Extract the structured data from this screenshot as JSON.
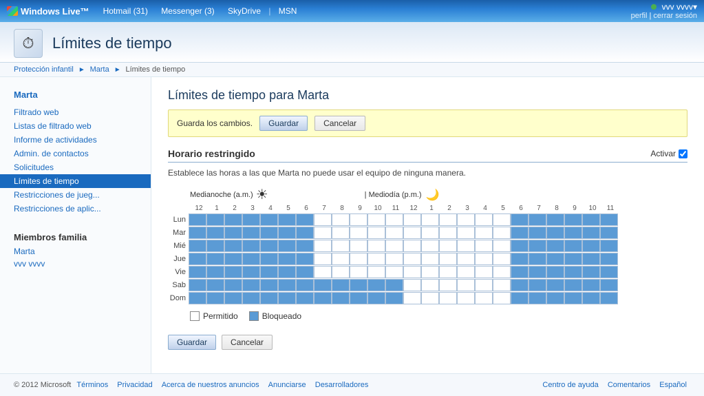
{
  "topbar": {
    "brand": "Windows Live™",
    "nav": [
      {
        "label": "Hotmail (31)",
        "id": "hotmail"
      },
      {
        "label": "Messenger (3)",
        "id": "messenger"
      },
      {
        "label": "SkyDrive",
        "id": "skydrive"
      },
      {
        "label": "MSN",
        "id": "msn"
      }
    ],
    "username": "vvv vvvv▾",
    "user_links": "perfil | cerrar sesión"
  },
  "page_header": {
    "title": "Límites de tiempo",
    "icon": "⏱"
  },
  "breadcrumb": {
    "items": [
      "Protección infantil",
      "Marta",
      "Límites de tiempo"
    ]
  },
  "sidebar": {
    "current_user": "Marta",
    "nav_items": [
      {
        "label": "Filtrado web",
        "id": "filtrado-web",
        "active": false
      },
      {
        "label": "Listas de filtrado web",
        "id": "listas-filtrado",
        "active": false
      },
      {
        "label": "Informe de actividades",
        "id": "informe",
        "active": false
      },
      {
        "label": "Admin. de contactos",
        "id": "admin-contactos",
        "active": false
      },
      {
        "label": "Solicitudes",
        "id": "solicitudes",
        "active": false
      },
      {
        "label": "Límites de tiempo",
        "id": "limites-tiempo",
        "active": true
      },
      {
        "label": "Restricciones de jueg...",
        "id": "restricciones-juegos",
        "active": false
      },
      {
        "label": "Restricciones de aplic...",
        "id": "restricciones-aplic",
        "active": false
      }
    ],
    "family_section": "Miembros familia",
    "members": [
      {
        "label": "Marta",
        "id": "member-marta"
      },
      {
        "label": "vvv vvvv",
        "id": "member-vvvv"
      }
    ]
  },
  "content": {
    "title": "Límites de tiempo para Marta",
    "save_bar_text": "Guarda los cambios.",
    "save_label": "Guardar",
    "cancel_label": "Cancelar",
    "section_title": "Horario restringido",
    "activate_label": "Activar",
    "description": "Establece las horas a las que Marta no puede usar el equipo de ninguna manera.",
    "label_midnight": "Medianoche (a.m.)",
    "label_noon": "| Mediodía (p.m.)",
    "hours": [
      "12",
      "1",
      "2",
      "3",
      "4",
      "5",
      "6",
      "7",
      "8",
      "9",
      "10",
      "11",
      "12",
      "1",
      "2",
      "3",
      "4",
      "5",
      "6",
      "7",
      "8",
      "9",
      "10",
      "11"
    ],
    "days": [
      "Lun",
      "Mar",
      "Mié",
      "Jue",
      "Vie",
      "Sab",
      "Dom"
    ],
    "grid": [
      [
        1,
        1,
        1,
        1,
        1,
        1,
        1,
        0,
        0,
        0,
        0,
        0,
        0,
        0,
        0,
        0,
        0,
        0,
        1,
        1,
        1,
        1,
        1,
        1
      ],
      [
        1,
        1,
        1,
        1,
        1,
        1,
        1,
        0,
        0,
        0,
        0,
        0,
        0,
        0,
        0,
        0,
        0,
        0,
        1,
        1,
        1,
        1,
        1,
        1
      ],
      [
        1,
        1,
        1,
        1,
        1,
        1,
        1,
        0,
        0,
        0,
        0,
        0,
        0,
        0,
        0,
        0,
        0,
        0,
        1,
        1,
        1,
        1,
        1,
        1
      ],
      [
        1,
        1,
        1,
        1,
        1,
        1,
        1,
        0,
        0,
        0,
        0,
        0,
        0,
        0,
        0,
        0,
        0,
        0,
        1,
        1,
        1,
        1,
        1,
        1
      ],
      [
        1,
        1,
        1,
        1,
        1,
        1,
        1,
        0,
        0,
        0,
        0,
        0,
        0,
        0,
        0,
        0,
        0,
        0,
        1,
        1,
        1,
        1,
        1,
        1
      ],
      [
        1,
        1,
        1,
        1,
        1,
        1,
        1,
        1,
        1,
        1,
        1,
        1,
        0,
        0,
        0,
        0,
        0,
        0,
        1,
        1,
        1,
        1,
        1,
        1
      ],
      [
        1,
        1,
        1,
        1,
        1,
        1,
        1,
        1,
        1,
        1,
        1,
        1,
        0,
        0,
        0,
        0,
        0,
        0,
        1,
        1,
        1,
        1,
        1,
        1
      ]
    ],
    "legend_allowed": "Permitido",
    "legend_blocked": "Bloqueado",
    "footer_save": "Guardar",
    "footer_cancel": "Cancelar"
  },
  "footer": {
    "copyright": "© 2012 Microsoft",
    "links_left": [
      "Términos",
      "Privacidad",
      "Acerca de nuestros anuncios",
      "Anunciarse",
      "Desarrolladores"
    ],
    "links_right": [
      "Centro de ayuda",
      "Comentarios",
      "Español"
    ]
  }
}
